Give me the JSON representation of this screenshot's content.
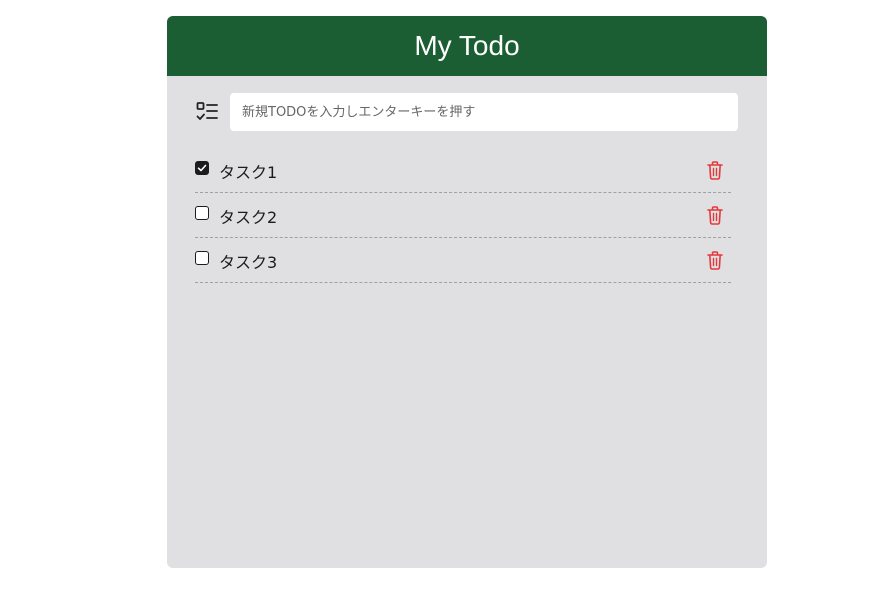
{
  "header": {
    "title": "My Todo"
  },
  "input": {
    "placeholder": "新規TODOを入力しエンターキーを押す",
    "value": ""
  },
  "colors": {
    "header_bg": "#1b5e33",
    "panel_bg": "#e0e0e2",
    "delete_icon": "#e5383b"
  },
  "icons": {
    "list": "checklist-icon",
    "delete": "trash-icon",
    "checkbox": "checkbox-icon"
  },
  "todos": [
    {
      "text": "タスク1",
      "done": true
    },
    {
      "text": "タスク2",
      "done": false
    },
    {
      "text": "タスク3",
      "done": false
    }
  ]
}
